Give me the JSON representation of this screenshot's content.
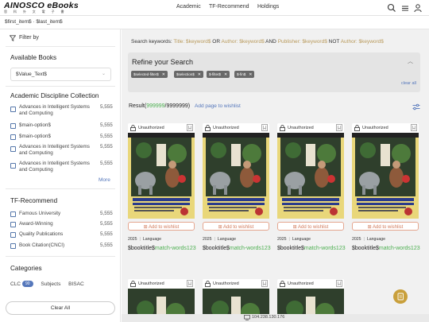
{
  "header": {
    "brand": "AINOSCO eBooks",
    "brand_sub": "思 科 外 文 電 子 書",
    "nav": [
      "Academic",
      "TF-Recommend",
      "Holdings"
    ]
  },
  "breadcrumb": "$first_item$ · $last_item$",
  "sidebar": {
    "filter_by": "Filter by",
    "available_books": {
      "title": "Available Books",
      "value": "$Value_Text$"
    },
    "academic": {
      "title": "Academic Discipline Collection",
      "items": [
        {
          "label": "Advances in Intelligent Systems and Computing",
          "count": "5,555"
        },
        {
          "label": "$main-option$",
          "count": "5,555"
        },
        {
          "label": "$main-option$",
          "count": "5,555"
        },
        {
          "label": "Advances in Intelligent Systems and Computing",
          "count": "5,555"
        },
        {
          "label": "Advances in Intelligent Systems and Computing",
          "count": "5,555"
        }
      ],
      "more": "More"
    },
    "tf_recommend": {
      "title": "TF-Recommend",
      "items": [
        {
          "label": "Famous University",
          "count": "5,555"
        },
        {
          "label": "Award-Winning",
          "count": "5,555"
        },
        {
          "label": "Quality Publications",
          "count": "5,555"
        },
        {
          "label": "Book Citation(CNCI)",
          "count": "5,555"
        }
      ]
    },
    "categories": {
      "title": "Categories",
      "tabs": [
        {
          "label": "CLC",
          "badge": "90"
        },
        {
          "label": "Subjects"
        },
        {
          "label": "BISAC"
        }
      ]
    },
    "clear_all": "Clear All"
  },
  "main": {
    "keywords": {
      "prefix": "Search keywords:",
      "title": "Title: $keyword$",
      "or": "OR",
      "author": "Author: $keyword$",
      "and": "AND",
      "publisher": "Publisher: $keyword$",
      "not": "NOT",
      "author2": "Author: $keyword$"
    },
    "refine": {
      "title": "Refine your Search",
      "chips": [
        "$selected-filter$",
        "$selection$",
        "$-filter$",
        "$-fin$"
      ],
      "clear": "clear all"
    },
    "result": {
      "label": "Result(",
      "count": "999999",
      "total": "/9999999)",
      "add_page": "Add page to wishlist"
    },
    "cards": [
      {
        "status": "Unauthorized",
        "wish": "Add to wishlist",
        "year": "2025",
        "language": "Language",
        "title": "$booktitle$",
        "match": "match-words123"
      },
      {
        "status": "Unauthorized",
        "wish": "Add to wishlist",
        "year": "2025",
        "language": "Language",
        "title": "$booktitle$",
        "match": "match-words123"
      },
      {
        "status": "Unauthorized",
        "wish": "Add to wishlist",
        "year": "2025",
        "language": "Language",
        "title": "$booktitle$",
        "match": "match-words123"
      },
      {
        "status": "Unauthorized",
        "wish": "Add to wishlist",
        "year": "2025",
        "language": "Language",
        "title": "$booktitle$",
        "match": "match-words123"
      },
      {
        "status": "Unauthorized"
      },
      {
        "status": "Unauthorized"
      },
      {
        "status": "Unauthorized"
      }
    ],
    "ip": "104.238.130.176"
  },
  "colors": {
    "accent": "#5577bb",
    "green": "#4caf50",
    "gold": "#c9a03c",
    "wish": "#d17a5b"
  }
}
